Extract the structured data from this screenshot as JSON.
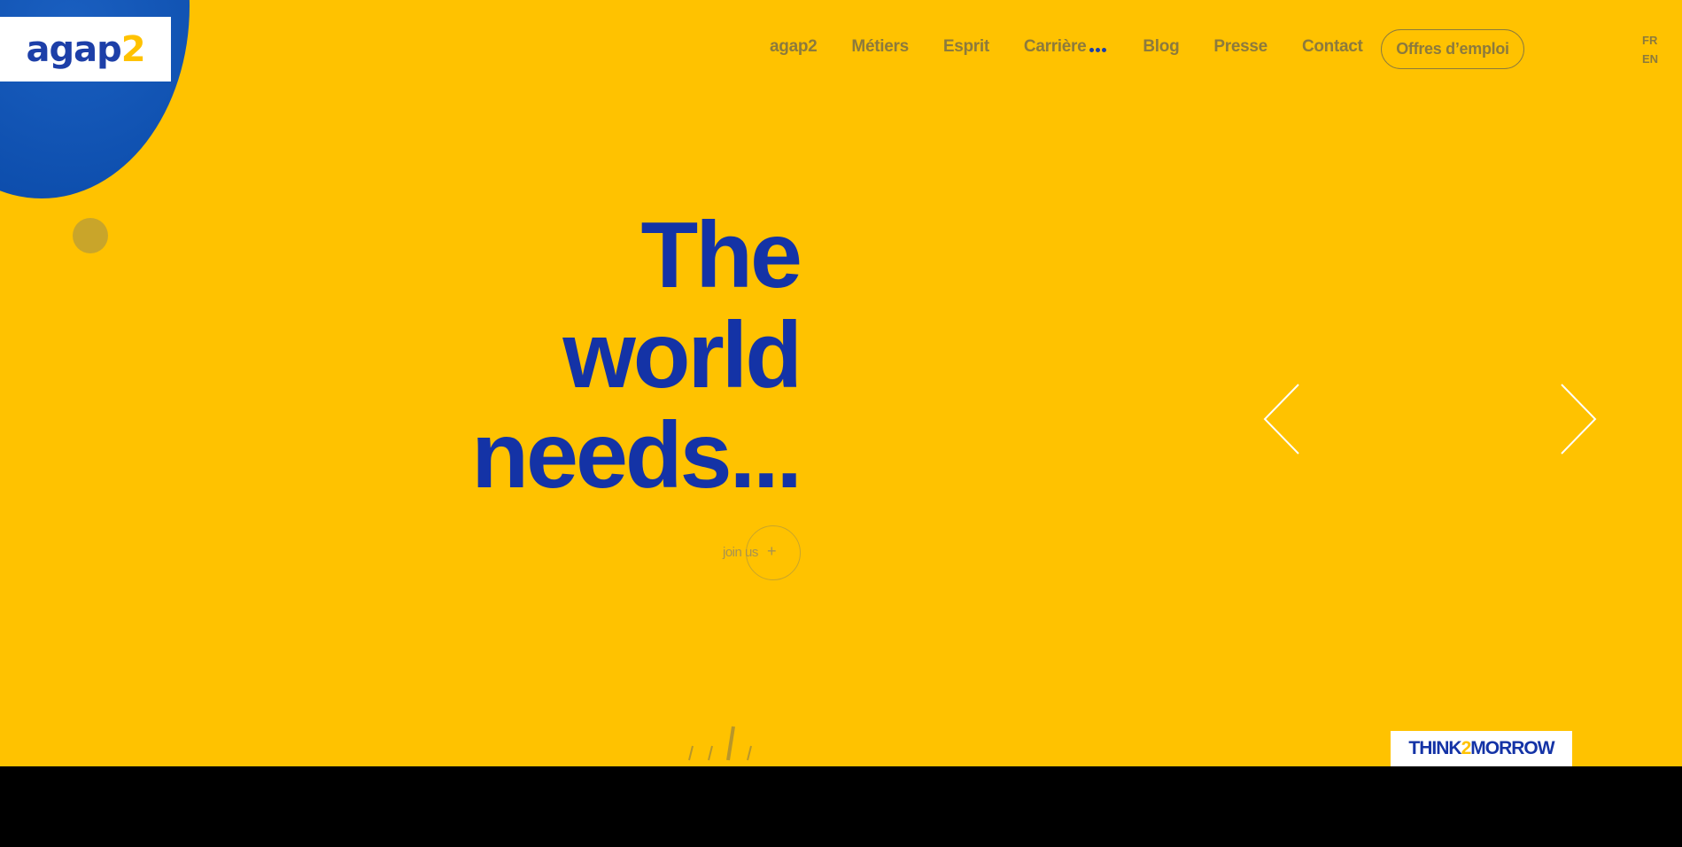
{
  "brand": {
    "logo_main": "agap",
    "logo_accent": "2",
    "colors": {
      "background": "#FFC200",
      "primary_blue": "#1433a6",
      "nav_text": "#8c7a3d"
    }
  },
  "nav": {
    "items": [
      {
        "label": "agap2"
      },
      {
        "label": "Métiers"
      },
      {
        "label": "Esprit"
      },
      {
        "label": "Carrière"
      },
      {
        "label": "Blog"
      },
      {
        "label": "Presse"
      },
      {
        "label": "Contact"
      }
    ],
    "cta_label": "Offres d’emploi",
    "languages": [
      "FR",
      "EN"
    ]
  },
  "hero": {
    "headline": [
      "The",
      "world",
      "needs..."
    ],
    "join_label": "join us",
    "join_plus": "+"
  },
  "slider": {
    "prev_icon": "chevron-left-icon",
    "next_icon": "chevron-right-icon",
    "pagination_count": 4,
    "active_index": 2
  },
  "badge": {
    "part1": "THINK",
    "part2": "2",
    "part3": "MORROW"
  }
}
